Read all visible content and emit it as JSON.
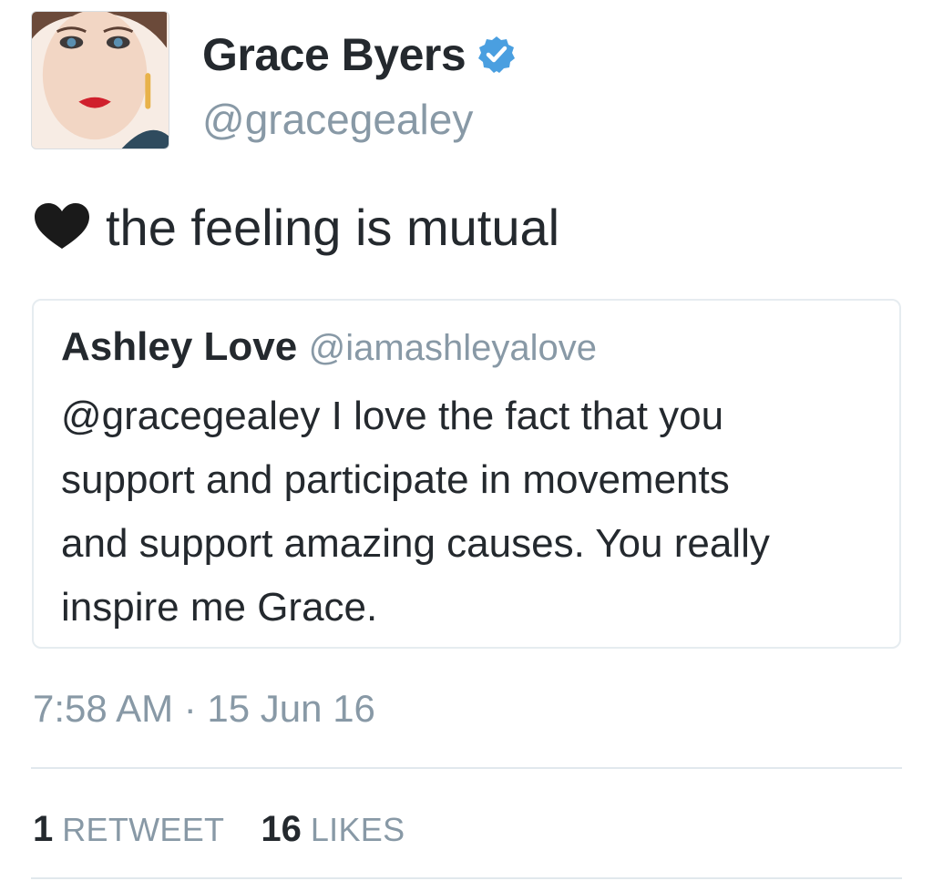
{
  "author": {
    "name": "Grace Byers",
    "handle": "@gracegealey",
    "verified": true,
    "avatar_icon": "profile-photo"
  },
  "tweet": {
    "icon": "heart-icon",
    "text": "the feeling is mutual"
  },
  "quoted_tweet": {
    "name": "Ashley Love",
    "handle": "@iamashleyalove",
    "text_lines": [
      "@gracegealey I love the fact that you",
      "support and participate in movements",
      "and support amazing causes. You really",
      "inspire me Grace."
    ]
  },
  "meta": {
    "timestamp": "7:58 AM · 15 Jun 16"
  },
  "stats": {
    "retweet_count": "1",
    "retweet_label": "RETWEET",
    "likes_count": "16",
    "likes_label": "LIKES"
  },
  "colors": {
    "verified_badge": "#4a9fe0",
    "muted_text": "#8899a6",
    "primary_text": "#24292e",
    "border": "#e6ecf0"
  }
}
